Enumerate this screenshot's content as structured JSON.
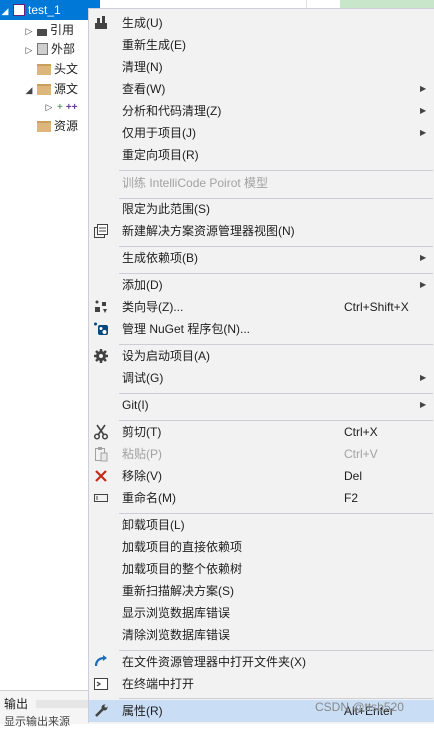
{
  "solution_explorer": {
    "project_row": "test_1",
    "items": [
      "引用",
      "外部",
      "头文",
      "源文",
      "资源"
    ],
    "cpp_marker": "++"
  },
  "output_pane": {
    "title": "输出",
    "subtitle": "显示输出来源"
  },
  "context_menu": {
    "build": "生成(U)",
    "rebuild": "重新生成(E)",
    "clean": "清理(N)",
    "view": "查看(W)",
    "analyze": "分析和代码清理(Z)",
    "project_only": "仅用于项目(J)",
    "retarget": "重定向项目(R)",
    "intellicode": "训练 IntelliCode Poirot 模型",
    "scope_to_this": "限定为此范围(S)",
    "new_view": "新建解决方案资源管理器视图(N)",
    "build_dependencies": "生成依赖项(B)",
    "add": "添加(D)",
    "class_wizard": "类向导(Z)...",
    "class_wizard_shortcut": "Ctrl+Shift+X",
    "manage_nuget": "管理 NuGet 程序包(N)...",
    "set_startup": "设为启动项目(A)",
    "debug": "调试(G)",
    "git": "Git(I)",
    "cut": "剪切(T)",
    "cut_shortcut": "Ctrl+X",
    "paste": "粘贴(P)",
    "paste_shortcut": "Ctrl+V",
    "remove": "移除(V)",
    "remove_shortcut": "Del",
    "rename": "重命名(M)",
    "rename_shortcut": "F2",
    "unload": "卸载项目(L)",
    "load_direct_deps": "加载项目的直接依赖项",
    "load_all_deps": "加载项目的整个依赖树",
    "rescan": "重新扫描解决方案(S)",
    "show_db_errors": "显示浏览数据库错误",
    "clear_db_errors": "清除浏览数据库错误",
    "open_in_explorer": "在文件资源管理器中打开文件夹(X)",
    "open_in_terminal": "在终端中打开",
    "properties": "属性(R)",
    "properties_shortcut": "Alt+Enter"
  },
  "watermark": "CSDN @ttsb520",
  "colors": {
    "menu_bg": "#f2f2f2",
    "highlight": "#c9def5",
    "selection": "#0078d7",
    "remove_icon": "#c42b1c",
    "open_folder_icon": "#1a6bbd"
  }
}
